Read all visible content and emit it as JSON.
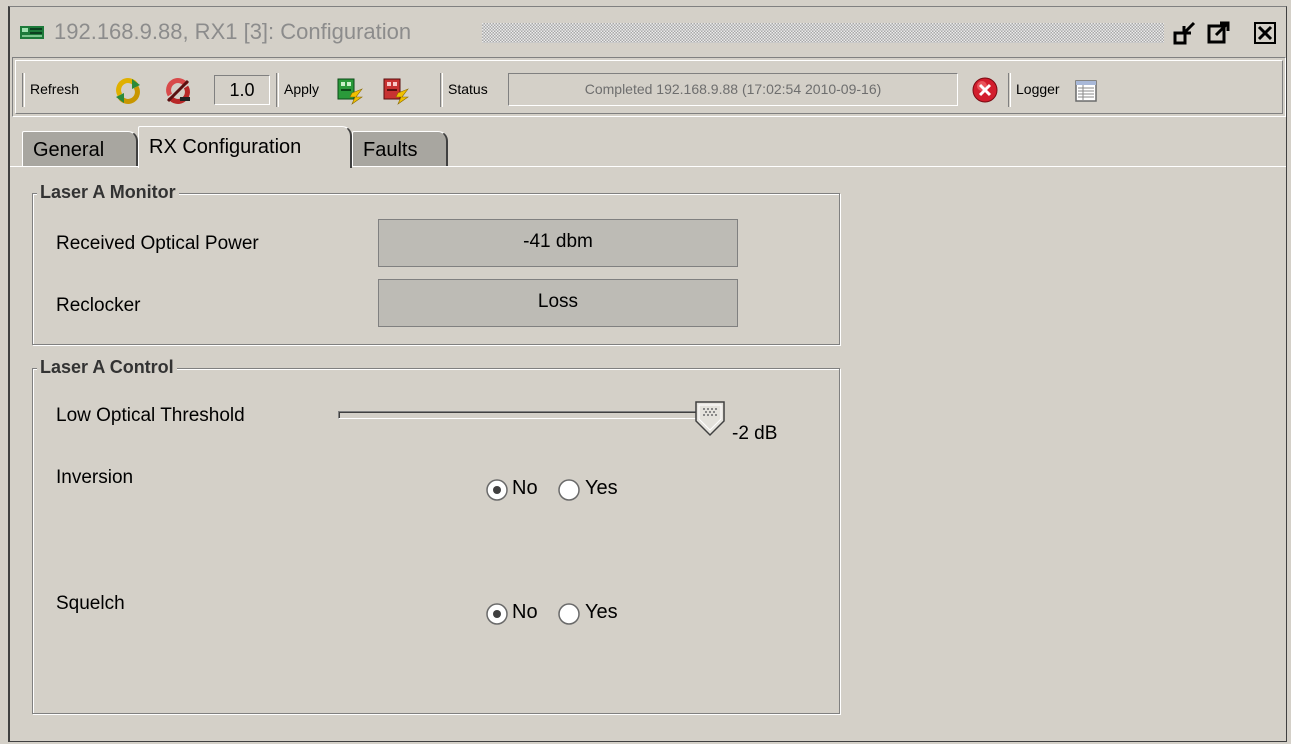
{
  "window": {
    "title": "192.168.9.88, RX1  [3]: Configuration"
  },
  "toolbar": {
    "refresh_label": "Refresh",
    "refresh_value": "1.0",
    "apply_label": "Apply",
    "status_label": "Status",
    "status_text": "Completed 192.168.9.88 (17:02:54  2010-09-16)",
    "logger_label": "Logger"
  },
  "tabs": [
    {
      "label": "General",
      "active": false
    },
    {
      "label": "RX Configuration",
      "active": true
    },
    {
      "label": "Faults",
      "active": false
    }
  ],
  "laser_monitor": {
    "title": "Laser A Monitor",
    "rows": [
      {
        "label": "Received Optical Power",
        "value": "-41 dbm"
      },
      {
        "label": "Reclocker",
        "value": "Loss"
      }
    ]
  },
  "laser_control": {
    "title": "Laser A Control",
    "threshold": {
      "label": "Low Optical Threshold",
      "value_text": "-2 dB",
      "level": 0.97
    },
    "inversion": {
      "label": "Inversion",
      "options": [
        "No",
        "Yes"
      ],
      "selected": "No"
    },
    "squelch": {
      "label": "Squelch",
      "options": [
        "No",
        "Yes"
      ],
      "selected": "No"
    }
  },
  "colors": {
    "background": "#d4d0c8",
    "readonly_field": "#bdbbb5",
    "status_text": "#6e6e6e",
    "error_icon": "#d21e2d"
  }
}
